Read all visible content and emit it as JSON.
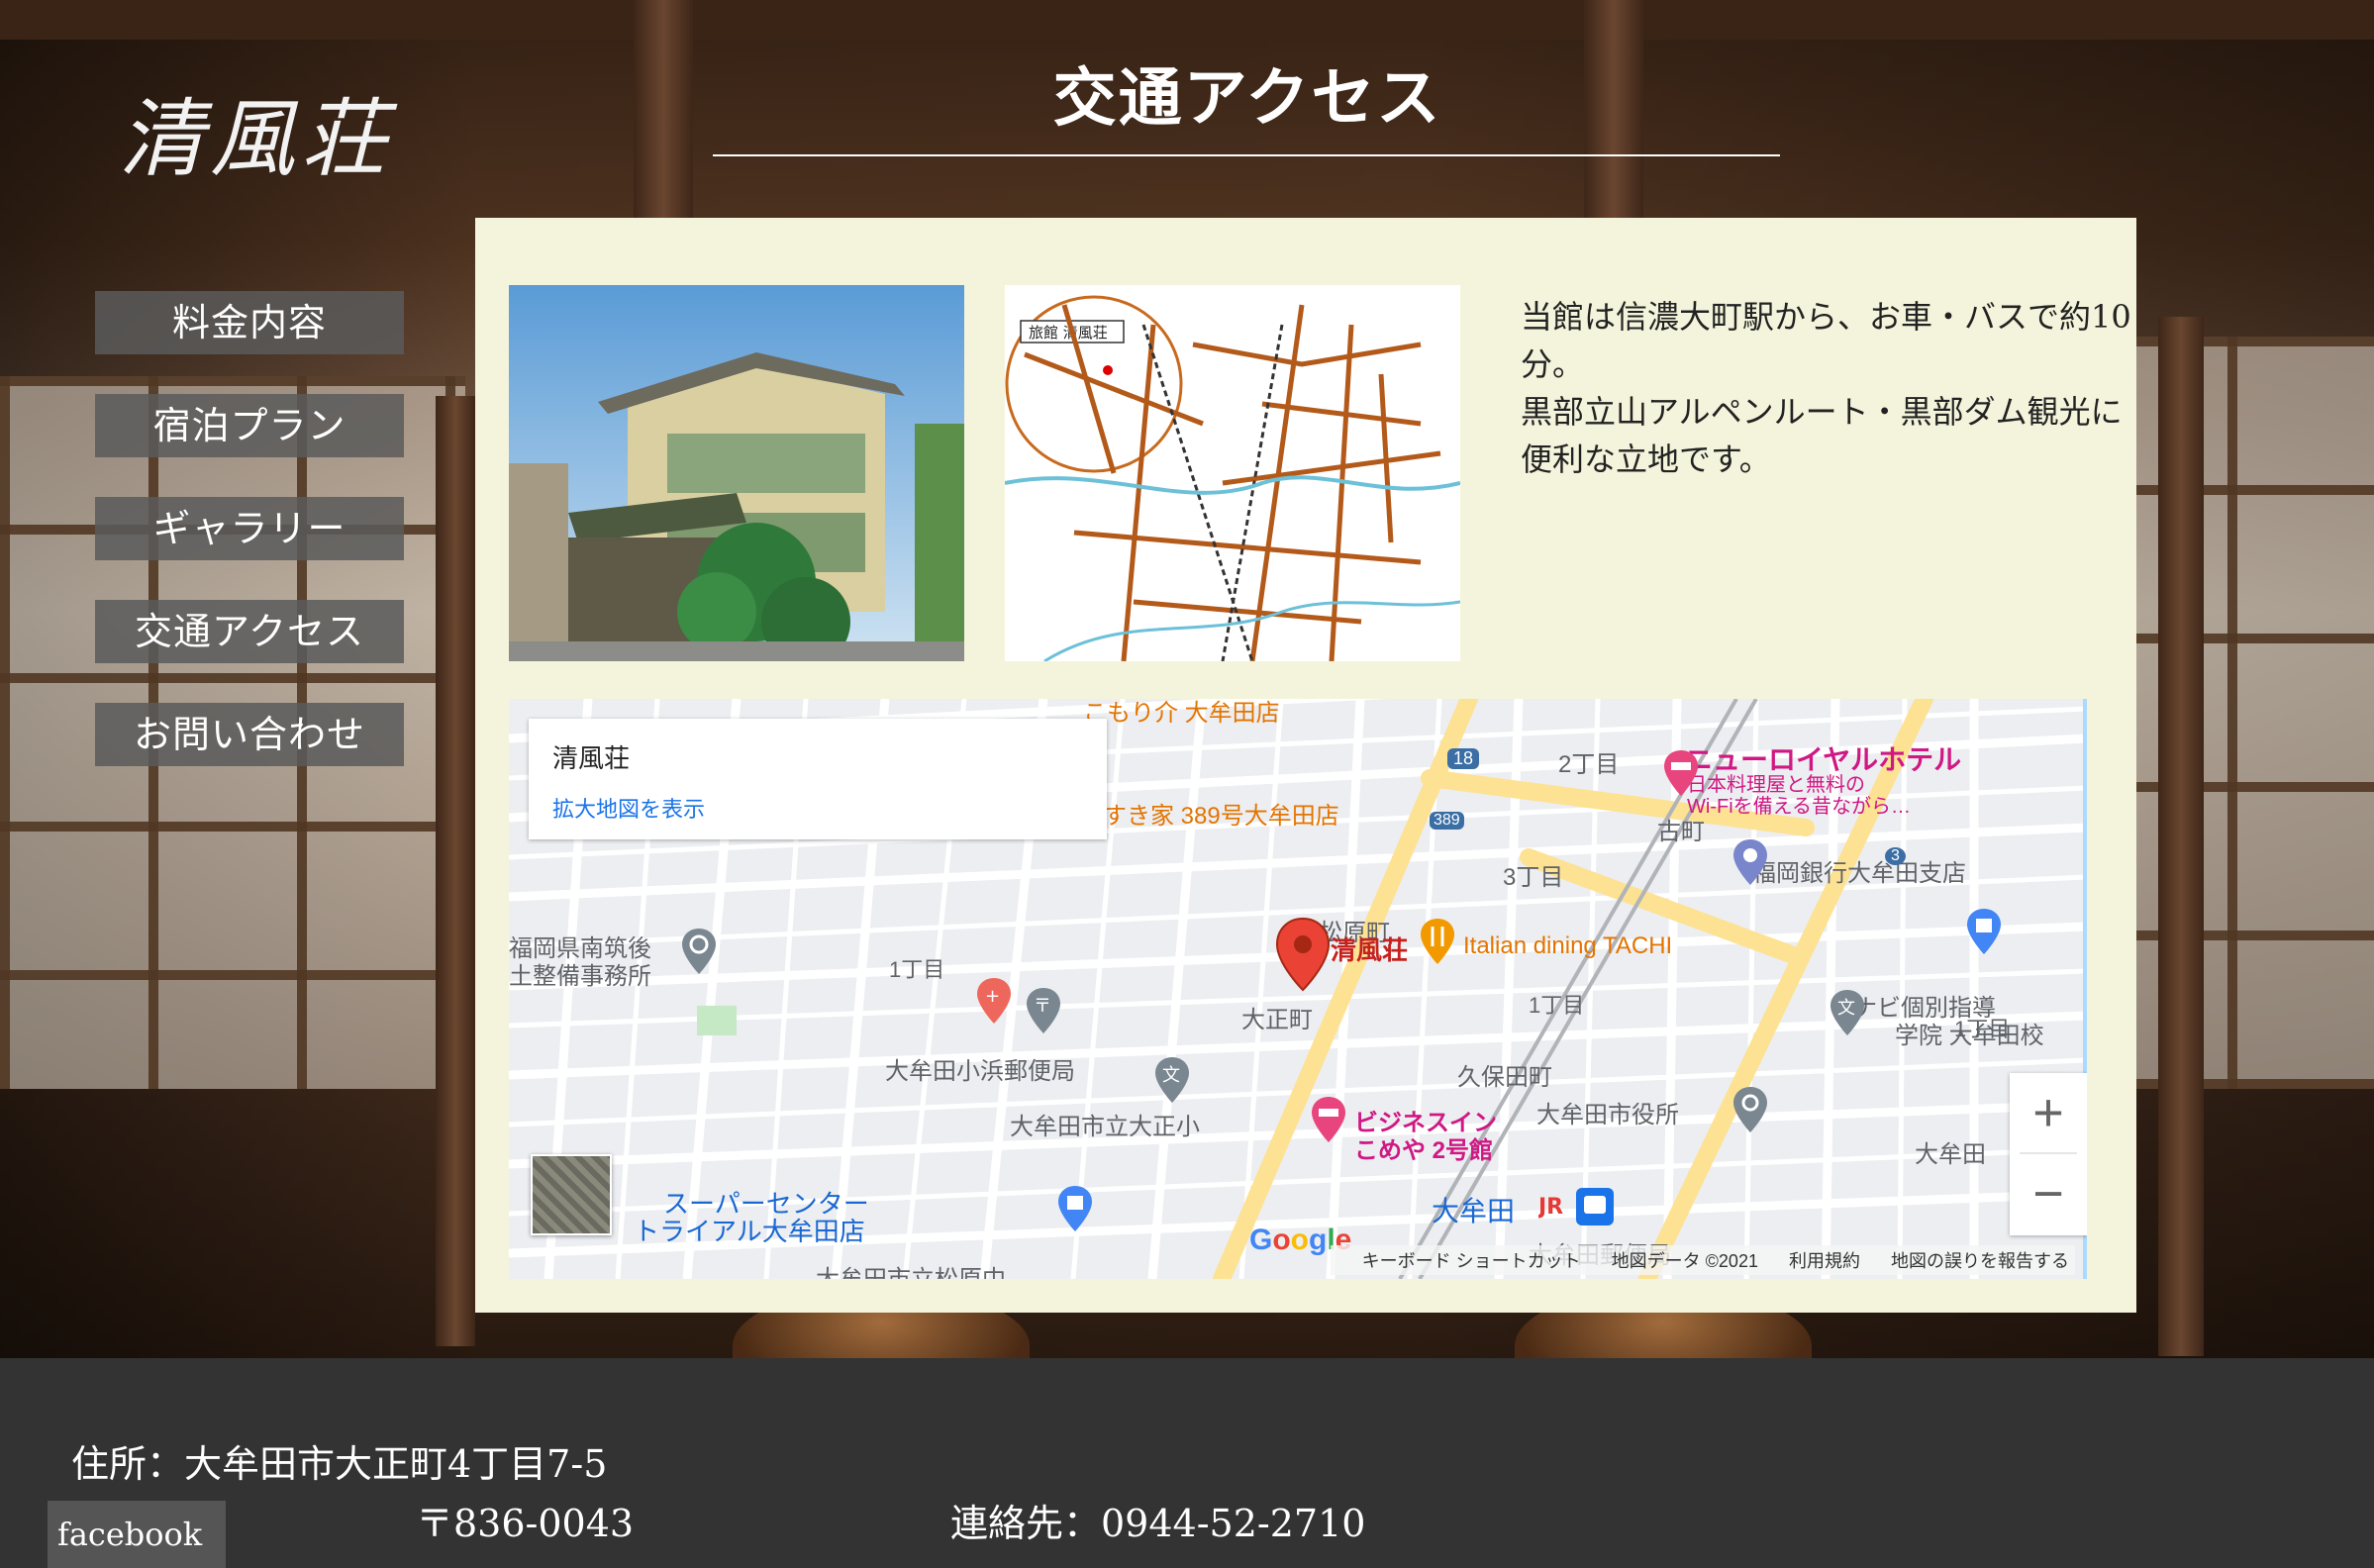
{
  "brand": {
    "logo_text": "清風荘"
  },
  "page": {
    "title": "交通アクセス"
  },
  "nav": {
    "items": [
      {
        "label": "料金内容"
      },
      {
        "label": "宿泊プラン"
      },
      {
        "label": "ギャラリー"
      },
      {
        "label": "交通アクセス"
      },
      {
        "label": "お問い合わせ"
      }
    ]
  },
  "access": {
    "description_line1": "当館は信濃大町駅から、お車・バスで約10分。",
    "description_line2": "黒部立山アルペンルート・黒部ダム観光に便利な立地です。",
    "route_map_label": "旅館 清風荘"
  },
  "map": {
    "place_name": "清風荘",
    "enlarge_link": "拡大地図を表示",
    "zoom_in": "+",
    "zoom_out": "−",
    "logo": "Google",
    "attribution": {
      "shortcuts": "キーボード ショートカット",
      "map_data": "地図データ ©2021",
      "terms": "利用規約",
      "report": "地図の誤りを報告する"
    },
    "labels": {
      "pin": "清風荘",
      "restaurant": "Italian dining TACHI",
      "sukiya": "すき家 389号大牟田店",
      "hotel_title": "ニューロイヤルホテル",
      "hotel_sub1": "日本料理屋と無料の",
      "hotel_sub2": "Wi-Fiを備える昔ながら…",
      "chome2": "2丁目",
      "chome3": "3丁目",
      "chome1a": "1丁目",
      "chome1b": "1丁目",
      "chome1c": "1丁目",
      "furumachi": "古町",
      "bank": "福岡銀行大牟田支店",
      "matsubara": "松原町",
      "taisho": "大正町",
      "kubota": "久保田町",
      "pref_office1": "福岡県南筑後",
      "pref_office2": "土整備事務所",
      "post_office": "大牟田小浜郵便局",
      "school": "大牟田市立大正小",
      "biz_inn1": "ビジネスイン",
      "biz_inn2": "こめや 2号館",
      "city_hall": "大牟田市役所",
      "juku1": "ナビ個別指導",
      "juku2": "学院 大牟田校",
      "super1": "スーパーセンター",
      "super2": "トライアル大牟田店",
      "station": "大牟田",
      "omuta_right": "大牟田",
      "post2": "大牟田郵便局",
      "route18": "18",
      "route389": "389",
      "route3": "3",
      "chugaku": "大牟田市立松原中",
      "top_partial": "こもり介 大牟田店"
    }
  },
  "footer": {
    "address": "住所：大牟田市大正町4丁目7-5",
    "postal": "〒836-0043",
    "contact": "連絡先：0944-52-2710",
    "facebook": "facebook"
  },
  "colors": {
    "panel_bg": "#f4f4dc",
    "nav_bg": "#5a5a5a",
    "footer_bg": "#333333",
    "map_pin": "#ea4335",
    "road_yellow": "#fde293"
  }
}
